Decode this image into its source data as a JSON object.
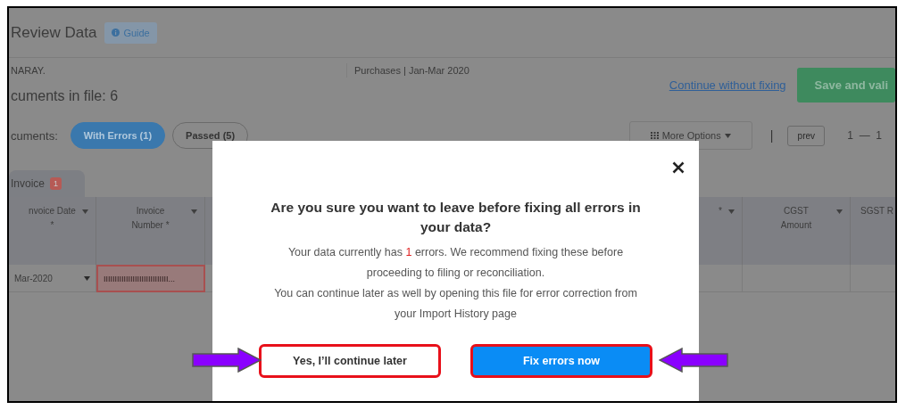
{
  "page": {
    "title": "Review Data",
    "guide_button": "Guide",
    "company": "NARAY.",
    "return_info": "Purchases |  Jan-Mar 2020",
    "documents_count": "cuments in file: 6",
    "continue_link": "Continue without fixing",
    "save_button": "Save and vali",
    "filter_label": "cuments:",
    "filters": [
      {
        "label": "With Errors (1)",
        "selected": true
      },
      {
        "label": "Passed (5)",
        "selected": false
      }
    ],
    "more_options": "More Options",
    "pager_separator": "|",
    "prev_button": "prev",
    "page_range": "1  —  1",
    "sheet_tabs": [
      {
        "label": "Invoice",
        "badge": "1",
        "selected": true
      }
    ],
    "columns": [
      {
        "label": "nvoice Date\n*",
        "filter": true
      },
      {
        "label": "Invoice\nNumber *",
        "filter": true
      },
      {
        "label": "*",
        "filter": true
      },
      {
        "label": "CGST\nAmount",
        "filter": true
      },
      {
        "label": "SGST R",
        "filter": false
      }
    ],
    "rows": [
      {
        "cells": [
          {
            "text": "Mar-2020",
            "kind": "dropdown",
            "error": false
          },
          {
            "text": "IIIIIIIIIIIIIIIIIIIIIIIIIIIII...",
            "kind": "text",
            "error": true
          }
        ]
      }
    ]
  },
  "dialog": {
    "title": "Are you sure you want to leave before fixing all errors in your data?",
    "message_before": "Your data currently has ",
    "error_count": "1",
    "message_after": " errors. We recommend fixing these before proceeding to filing or reconciliation.",
    "note": "You can continue later as well by opening this file for error correction from your Import History page",
    "buttons": [
      {
        "label": "Yes, I’ll continue later",
        "kind": "secondary",
        "highlighted": true
      },
      {
        "label": "Fix errors now",
        "kind": "primary",
        "highlighted": true
      }
    ]
  }
}
